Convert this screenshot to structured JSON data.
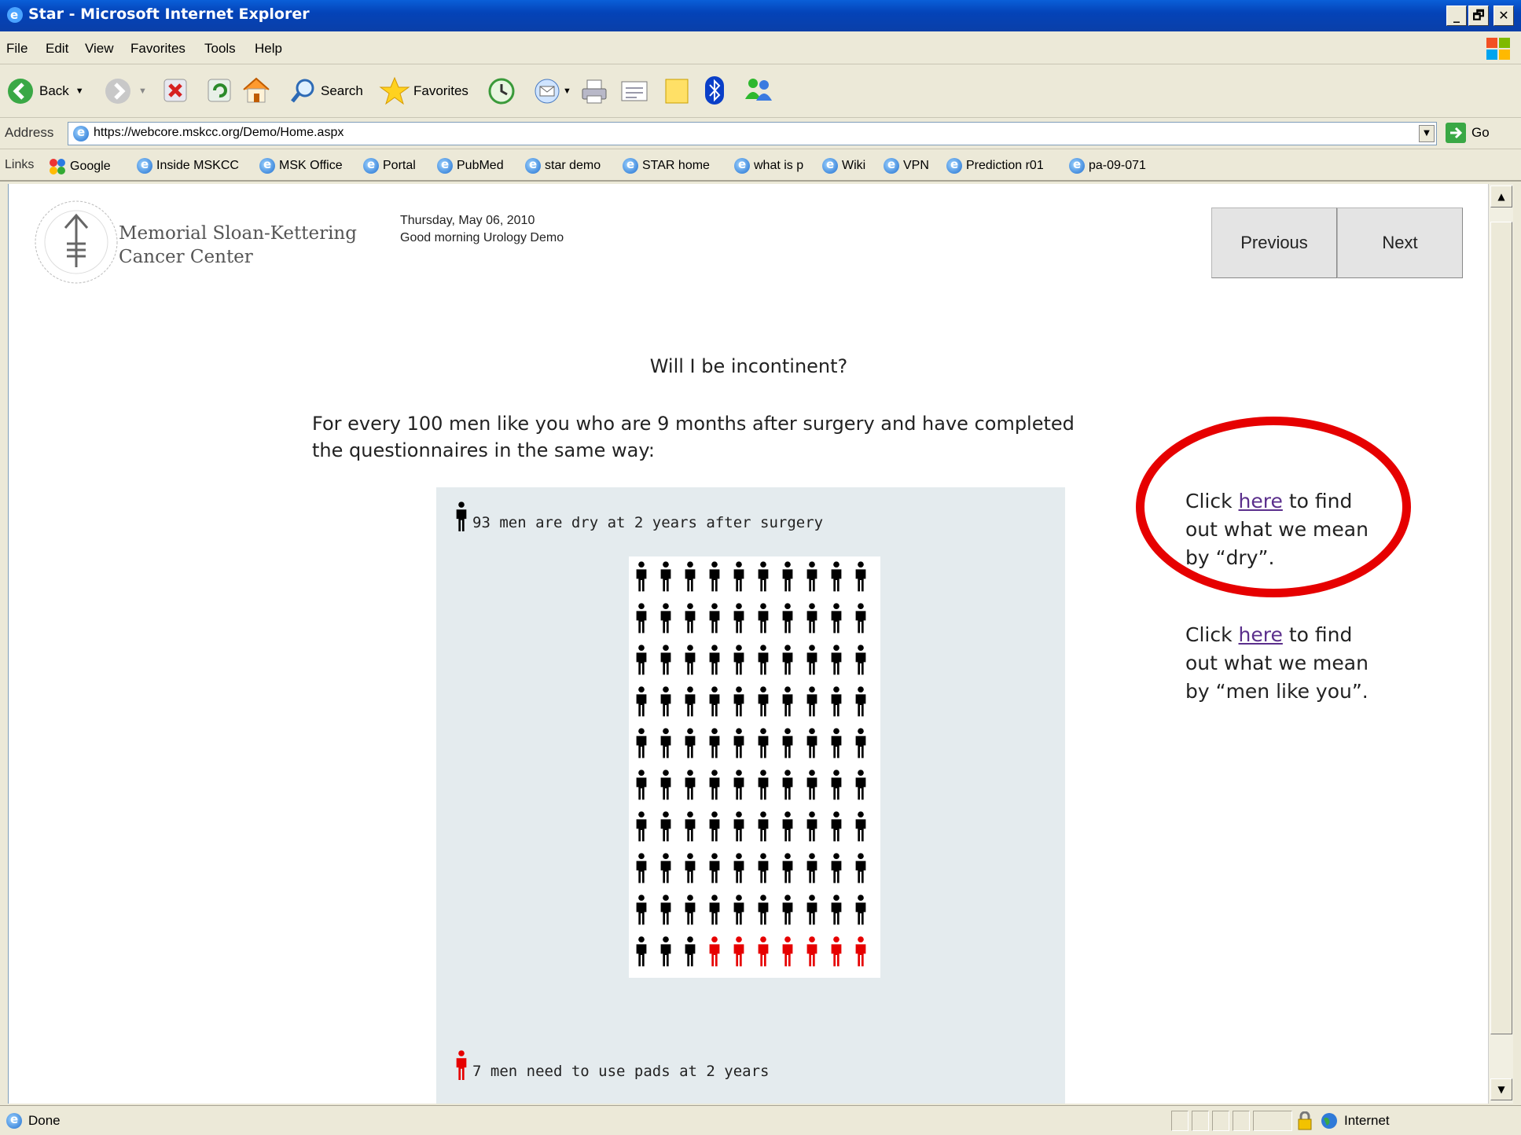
{
  "window": {
    "title": "Star - Microsoft Internet Explorer",
    "controls": [
      "_",
      "🗗",
      "✕"
    ]
  },
  "menu": [
    "File",
    "Edit",
    "View",
    "Favorites",
    "Tools",
    "Help"
  ],
  "toolbar": {
    "back_label": "Back",
    "search_label": "Search",
    "favorites_label": "Favorites"
  },
  "address": {
    "label": "Address",
    "url": "https://webcore.mskcc.org/Demo/Home.aspx",
    "go_label": "Go"
  },
  "links": {
    "label": "Links",
    "items": [
      "Google",
      "Inside MSKCC",
      "MSK Office",
      "Portal",
      "PubMed",
      "star demo",
      "STAR home",
      "what is p",
      "Wiki",
      "VPN",
      "Prediction r01",
      "pa-09-071"
    ]
  },
  "page": {
    "logo_line1": "Memorial Sloan-Kettering",
    "logo_line2": "Cancer Center",
    "date": "Thursday, May 06, 2010",
    "greeting": "Good morning Urology Demo",
    "previous_label": "Previous",
    "next_label": "Next",
    "question": "Will I be incontinent?",
    "intro": "For every 100 men like you who are 9 months after surgery and have completed the questionnaires in the same way:",
    "legend_dry": "93 men are dry at 2 years after surgery",
    "legend_pads": "7 men need to use pads at 2 years",
    "side_dry": {
      "before": "Click ",
      "link": "here",
      "after": " to find out what we mean by “dry”."
    },
    "side_men": {
      "before": "Click ",
      "link": "here",
      "after": " to find out what we mean by “men like you”."
    }
  },
  "chart_data": {
    "type": "icon-array",
    "total": 100,
    "rows": 10,
    "columns": 10,
    "series": [
      {
        "name": "93 men are dry at 2 years after surgery",
        "count": 93,
        "color": "#000000"
      },
      {
        "name": "7 men need to use pads at 2 years",
        "count": 7,
        "color": "#e60000"
      }
    ]
  },
  "status": {
    "text": "Done",
    "zone": "Internet"
  }
}
